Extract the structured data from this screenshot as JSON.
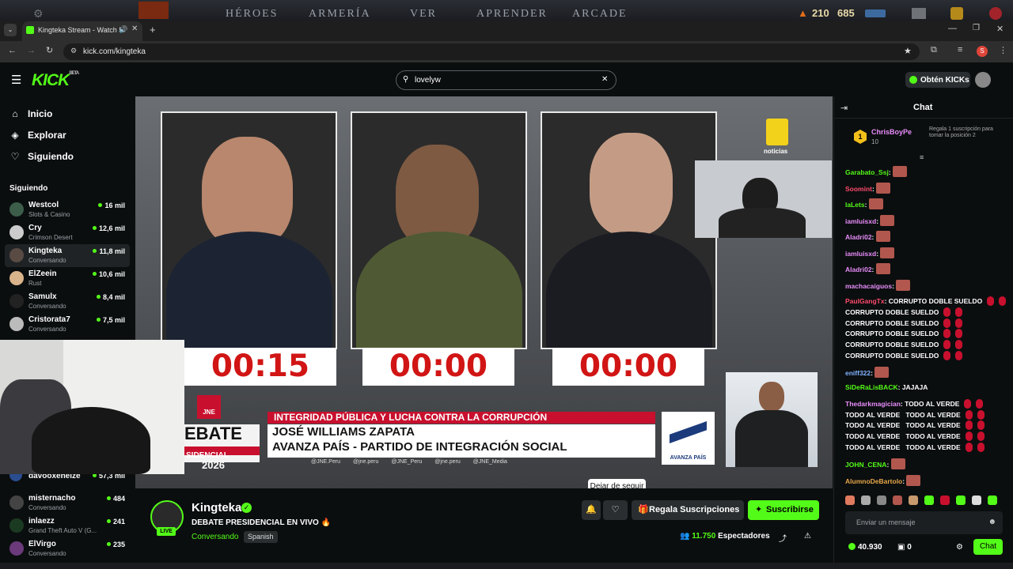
{
  "game_bar": {
    "nav": [
      "HÉROES",
      "ARMERÍA",
      "VER",
      "APRENDER",
      "ARCADE"
    ],
    "currency": [
      "210",
      "685"
    ]
  },
  "browser": {
    "tab_title": "Kingteka Stream - Watch Li",
    "url": "kick.com/kingteka",
    "profile_initial": "S"
  },
  "header": {
    "logo": "KICK",
    "logo_badge": "BETA",
    "search_value": "lovelyw",
    "get_kicks_label": "Obtén KICKs"
  },
  "sidebar": {
    "nav": [
      {
        "label": "Inicio",
        "icon": "home-icon"
      },
      {
        "label": "Explorar",
        "icon": "compass-icon"
      },
      {
        "label": "Siguiendo",
        "icon": "heart-icon"
      }
    ],
    "section_title": "Siguiendo",
    "channels": [
      {
        "name": "Westcol",
        "category": "Slots & Casino",
        "viewers": "16 mil"
      },
      {
        "name": "Cry",
        "category": "Crimson Desert",
        "viewers": "12,6 mil"
      },
      {
        "name": "Kingteka",
        "category": "Conversando",
        "viewers": "11,8 mil"
      },
      {
        "name": "ElZeein",
        "category": "Rust",
        "viewers": "10,6 mil"
      },
      {
        "name": "Samulx",
        "category": "Conversando",
        "viewers": "8,4 mil"
      },
      {
        "name": "Cristorata7",
        "category": "Conversando",
        "viewers": "7,5 mil"
      },
      {
        "name": "davooxeneize",
        "category": "",
        "viewers": "57,3 mil"
      },
      {
        "name": "misternacho",
        "category": "Conversando",
        "viewers": "484"
      },
      {
        "name": "inlaezz",
        "category": "Grand Theft Auto V (G...",
        "viewers": "241"
      },
      {
        "name": "ElVirgo",
        "category": "Conversando",
        "viewers": "235"
      }
    ]
  },
  "video": {
    "timers": [
      "00:15",
      "00:00",
      "00:00"
    ],
    "banner_topic": "INTEGRIDAD PÚBLICA Y LUCHA CONTRA LA CORRUPCIÓN",
    "banner_name": "JOSÉ WILLIAMS ZAPATA",
    "banner_party": "AVANZA PAÍS - PARTIDO DE INTEGRACIÓN SOCIAL",
    "debate_label": "EBATE",
    "debate_sub": "SIDENCIAL",
    "debate_year": "2026",
    "jne": "JNE",
    "socials": "@JNE.Peru @jne.peru @JNE_Peru @jne.peru @JNE_Media",
    "party_logo_text": "AVANZA PAÍS",
    "network_logo_text": "noticias"
  },
  "tooltip": "Dejar de seguir",
  "stream_info": {
    "channel_name": "Kingteka",
    "live_badge": "LIVE",
    "title": "DEBATE PRESIDENCIAL EN VIVO 🔥",
    "category": "Conversando",
    "language": "Spanish",
    "gift_label": "Regala Suscripciones",
    "subscribe_label": "Suscribirse",
    "viewers_count": "11.750",
    "viewers_label": "Espectadores"
  },
  "chat": {
    "title": "Chat",
    "pinned": {
      "rank": "1",
      "user": "ChrisBoyPe",
      "count": "10",
      "note": "Regala 1 suscripción para tomar la posición 2"
    },
    "messages": [
      {
        "user": "Garabato_Ssj",
        "color": "#53fc18",
        "text": ""
      },
      {
        "user": "Soomint",
        "color": "#ff4b6e",
        "text": ""
      },
      {
        "user": "laLets",
        "color": "#53fc18",
        "text": ""
      },
      {
        "user": "iamluisxd",
        "color": "#e88dfa",
        "text": ""
      },
      {
        "user": "Aladri02",
        "color": "#e88dfa",
        "text": ""
      },
      {
        "user": "iamluisxd",
        "color": "#e88dfa",
        "text": ""
      },
      {
        "user": "Aladri02",
        "color": "#e88dfa",
        "text": ""
      },
      {
        "user": "machacaiguos",
        "color": "#e88dfa",
        "text": ""
      },
      {
        "user": "PaulGangTx",
        "color": "#ff4b6e",
        "text": "CORRUPTO DOBLE SUELDO"
      },
      {
        "user": "",
        "color": "#fff",
        "text": "CORRUPTO DOBLE SUELDO"
      },
      {
        "user": "",
        "color": "#fff",
        "text": "CORRUPTO DOBLE SUELDO"
      },
      {
        "user": "",
        "color": "#fff",
        "text": "CORRUPTO DOBLE SUELDO"
      },
      {
        "user": "",
        "color": "#fff",
        "text": "CORRUPTO DOBLE SUELDO"
      },
      {
        "user": "",
        "color": "#fff",
        "text": "CORRUPTO DOBLE SUELDO"
      },
      {
        "user": "eniff322",
        "color": "#7fb2ff",
        "text": ""
      },
      {
        "user": "SiDeRaLisBACK",
        "color": "#53fc18",
        "text": "JAJAJA"
      },
      {
        "user": "Thedarkmagician",
        "color": "#e88dfa",
        "text": "TODO AL VERDE"
      },
      {
        "user": "",
        "color": "#fff",
        "text": "TODO AL VERDE   TODO AL VERDE"
      },
      {
        "user": "",
        "color": "#fff",
        "text": "TODO AL VERDE   TODO AL VERDE"
      },
      {
        "user": "",
        "color": "#fff",
        "text": "TODO AL VERDE   TODO AL VERDE"
      },
      {
        "user": "",
        "color": "#fff",
        "text": "TODO AL VERDE   TODO AL VERDE"
      },
      {
        "user": "JOHN_CENA",
        "color": "#53fc18",
        "text": ""
      },
      {
        "user": "AlumnoDeBartolo",
        "color": "#e8a84a",
        "text": ""
      }
    ],
    "input_placeholder": "Enviar un mensaje",
    "kicks_balance": "40.930",
    "chest_count": "0",
    "send_label": "Chat"
  },
  "colors": {
    "brand": "#53fc18",
    "background": "#0b0e0f",
    "accent_red": "#c8102e"
  }
}
